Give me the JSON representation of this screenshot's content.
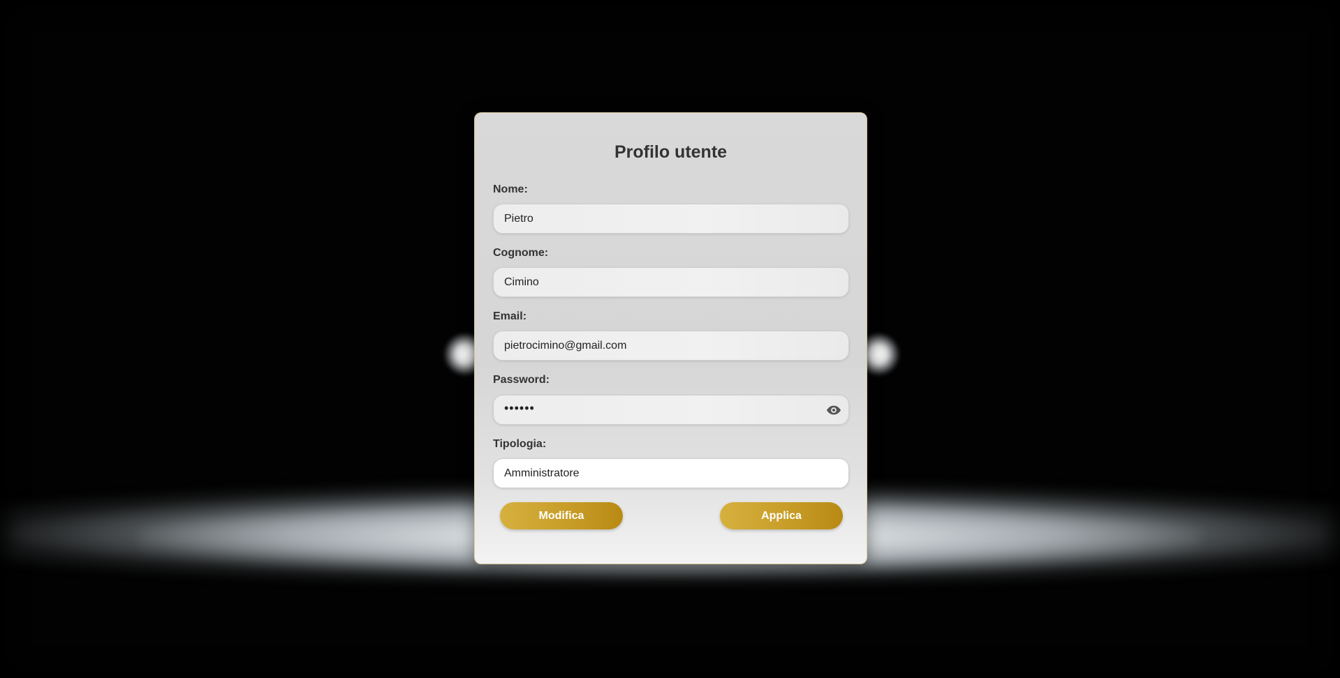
{
  "form": {
    "title": "Profilo utente",
    "fields": {
      "nome": {
        "label": "Nome:",
        "value": "Pietro"
      },
      "cognome": {
        "label": "Cognome:",
        "value": "Cimino"
      },
      "email": {
        "label": "Email:",
        "value": "pietrocimino@gmail.com"
      },
      "password": {
        "label": "Password:",
        "value": "••••••",
        "toggle_icon": "eye-icon"
      },
      "tipologia": {
        "label": "Tipologia:",
        "value": "Amministratore"
      }
    },
    "buttons": {
      "modifica": "Modifica",
      "applica": "Applica"
    }
  },
  "colors": {
    "accent_gold": "#c99f2a",
    "card_background": "#d8d8d8",
    "page_background": "#020202",
    "text": "#333333"
  }
}
